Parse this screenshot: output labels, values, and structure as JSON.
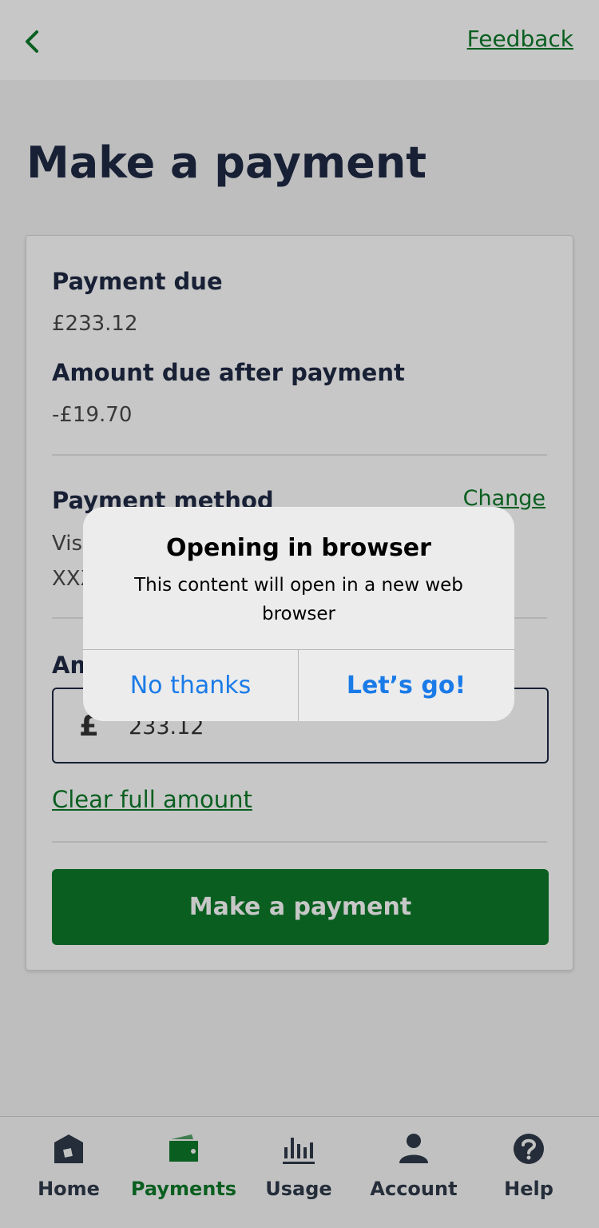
{
  "header": {
    "feedback_label": "Feedback"
  },
  "page": {
    "title": "Make a payment"
  },
  "card": {
    "payment_due_label": "Payment due",
    "payment_due_value": "£233.12",
    "after_payment_label": "Amount due after payment",
    "after_payment_value": "-£19.70",
    "method_label": "Payment method",
    "method_change": "Change",
    "method_line1": "Visa",
    "method_line2": "XXX",
    "amount_label": "Am",
    "currency_symbol": "£",
    "amount_value": "233.12",
    "clear_label": "Clear full amount",
    "submit_label": "Make a payment"
  },
  "dialog": {
    "title": "Opening in browser",
    "message": "This content will open in a new web browser",
    "cancel_label": "No thanks",
    "confirm_label": "Let’s go!"
  },
  "tabbar": {
    "items": [
      {
        "label": "Home",
        "icon": "home-icon"
      },
      {
        "label": "Payments",
        "icon": "wallet-icon",
        "active": true
      },
      {
        "label": "Usage",
        "icon": "bar-chart-icon"
      },
      {
        "label": "Account",
        "icon": "person-icon"
      },
      {
        "label": "Help",
        "icon": "question-icon"
      }
    ]
  },
  "colors": {
    "accent": "#0d7a2a",
    "text": "#1f2a44",
    "dialog_button": "#1a7be8"
  }
}
